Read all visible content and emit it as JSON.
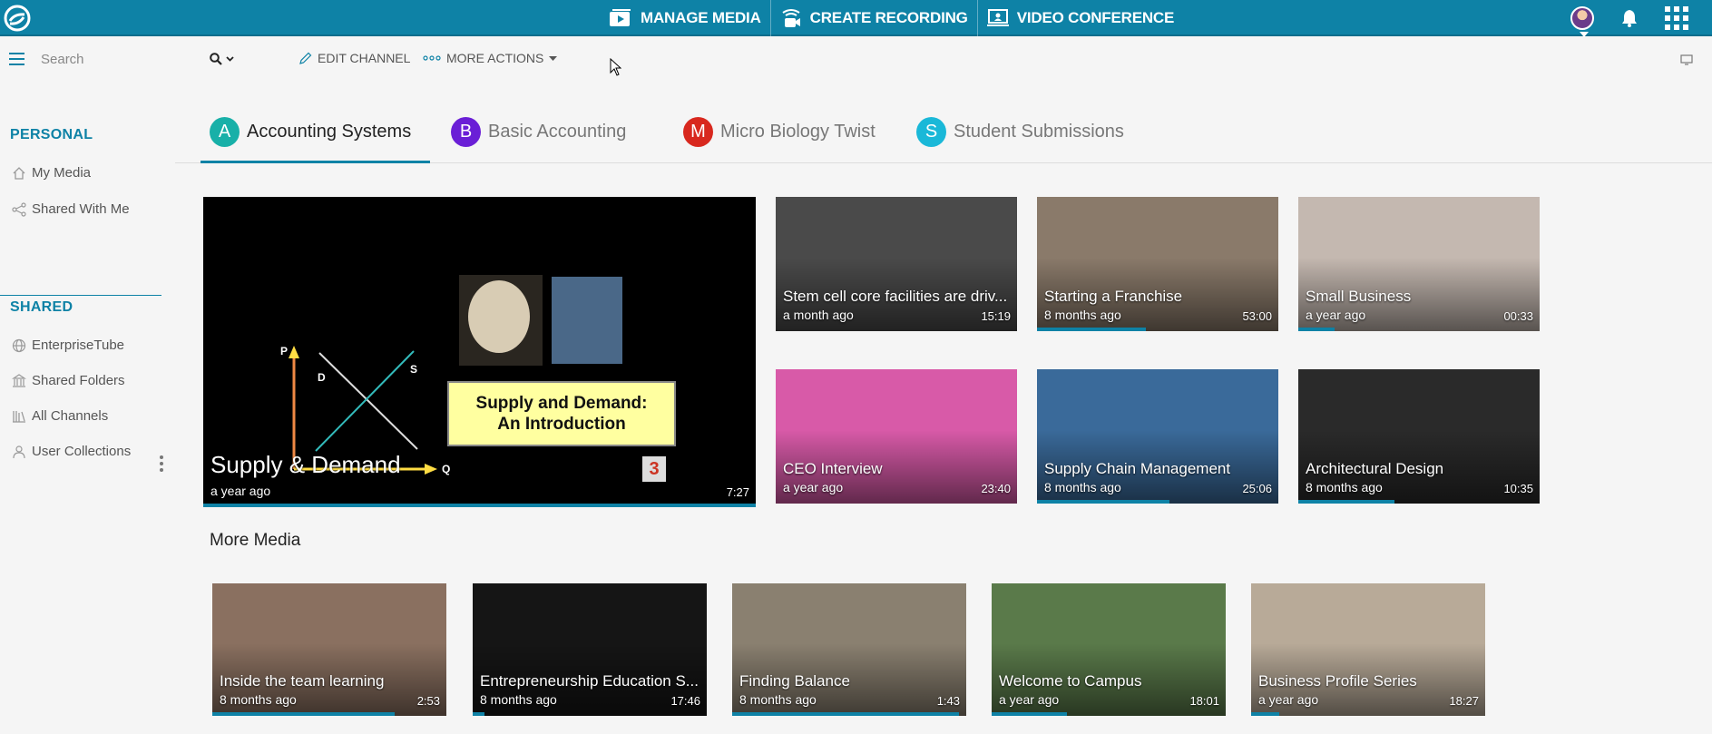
{
  "topnav": {
    "manage_media": "MANAGE MEDIA",
    "create_recording": "CREATE RECORDING",
    "video_conference": "VIDEO CONFERENCE"
  },
  "search": {
    "placeholder": "Search"
  },
  "toolbar": {
    "edit_channel": "EDIT CHANNEL",
    "more_actions": "MORE ACTIONS"
  },
  "sidebar": {
    "personal_title": "PERSONAL",
    "personal_items": [
      {
        "label": "My Media",
        "icon": "home-icon"
      },
      {
        "label": "Shared With Me",
        "icon": "share-icon"
      }
    ],
    "shared_title": "SHARED",
    "shared_items": [
      {
        "label": "EnterpriseTube",
        "icon": "globe-icon"
      },
      {
        "label": "Shared Folders",
        "icon": "building-icon"
      },
      {
        "label": "All Channels",
        "icon": "library-icon"
      },
      {
        "label": "User Collections",
        "icon": "user-icon"
      }
    ]
  },
  "tabs": [
    {
      "letter": "A",
      "label": "Accounting Systems",
      "color": "#18b0a8",
      "active": true
    },
    {
      "letter": "B",
      "label": "Basic Accounting",
      "color": "#6a1fd6",
      "active": false
    },
    {
      "letter": "M",
      "label": "Micro Biology Twist",
      "color": "#d8281e",
      "active": false
    },
    {
      "letter": "S",
      "label": "Student Submissions",
      "color": "#1ab8d8",
      "active": false
    }
  ],
  "featured": {
    "title": "Supply & Demand",
    "ago": "a year ago",
    "duration": "7:27",
    "progress": 1.0,
    "slide_title_line1": "Supply and Demand:",
    "slide_title_line2": "An Introduction",
    "axis_p": "P",
    "axis_q": "Q",
    "label_d": "D",
    "label_s": "S",
    "page_number": "3"
  },
  "grid": [
    {
      "title": "Stem cell core facilities are driv...",
      "ago": "a month ago",
      "duration": "15:19",
      "progress": 0,
      "thumb": "#4a4a4a"
    },
    {
      "title": "Starting a Franchise",
      "ago": "8 months ago",
      "duration": "53:00",
      "progress": 0.45,
      "thumb": "#8a7a6a"
    },
    {
      "title": "Small Business",
      "ago": "a year ago",
      "duration": "00:33",
      "progress": 0.15,
      "thumb": "#c4b8b0"
    },
    {
      "title": "CEO Interview",
      "ago": "a year ago",
      "duration": "23:40",
      "progress": 0,
      "thumb": "#d85aa8"
    },
    {
      "title": "Supply Chain Management",
      "ago": "8 months ago",
      "duration": "25:06",
      "progress": 0.55,
      "thumb": "#3a6a9a"
    },
    {
      "title": "Architectural Design",
      "ago": "8 months ago",
      "duration": "10:35",
      "progress": 0.4,
      "thumb": "#2a2a2a"
    }
  ],
  "more_media_title": "More Media",
  "more_media": [
    {
      "title": "Inside the team learning",
      "ago": "8 months ago",
      "duration": "2:53",
      "progress": 0.78,
      "thumb": "#8a7060"
    },
    {
      "title": "Entrepreneurship Education S...",
      "ago": "8 months ago",
      "duration": "17:46",
      "progress": 0.05,
      "thumb": "#151515"
    },
    {
      "title": "Finding Balance",
      "ago": "8 months ago",
      "duration": "1:43",
      "progress": 0.97,
      "thumb": "#8a8070"
    },
    {
      "title": "Welcome to Campus",
      "ago": "a year ago",
      "duration": "18:01",
      "progress": 0.32,
      "thumb": "#5a7a4a"
    },
    {
      "title": "Business Profile Series",
      "ago": "a year ago",
      "duration": "18:27",
      "progress": 0.12,
      "thumb": "#b8aa98"
    }
  ]
}
